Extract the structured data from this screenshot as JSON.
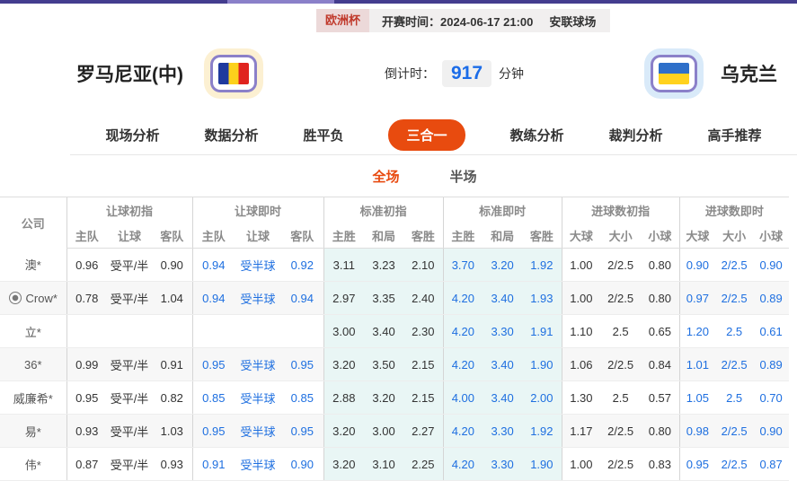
{
  "top_bar": {
    "accent_color": "#443d8f",
    "highlight_color": "#8a80c9"
  },
  "match_header": {
    "league": "欧洲杯",
    "kickoff_label": "开赛时间：2024-06-17 21:00",
    "venue": "安联球场"
  },
  "teams": {
    "home": {
      "name": "罗马尼亚(中)",
      "flag": "romania-flag"
    },
    "away": {
      "name": "乌克兰",
      "flag": "ukraine-flag"
    }
  },
  "countdown": {
    "label": "倒计时：",
    "value": "917",
    "unit": "分钟"
  },
  "nav_tabs": [
    {
      "label": "现场分析",
      "active": false
    },
    {
      "label": "数据分析",
      "active": false
    },
    {
      "label": "胜平负",
      "active": false
    },
    {
      "label": "三合一",
      "active": true
    },
    {
      "label": "教练分析",
      "active": false
    },
    {
      "label": "裁判分析",
      "active": false
    },
    {
      "label": "高手推荐",
      "active": false
    }
  ],
  "sub_tabs": [
    {
      "label": "全场",
      "active": true
    },
    {
      "label": "半场",
      "active": false
    }
  ],
  "odds_table": {
    "company_header": "公司",
    "groups": [
      {
        "label": "让球初指",
        "columns": [
          "主队",
          "让球",
          "客队"
        ]
      },
      {
        "label": "让球即时",
        "columns": [
          "主队",
          "让球",
          "客队"
        ]
      },
      {
        "label": "标准初指",
        "columns": [
          "主胜",
          "和局",
          "客胜"
        ]
      },
      {
        "label": "标准即时",
        "columns": [
          "主胜",
          "和局",
          "客胜"
        ]
      },
      {
        "label": "进球数初指",
        "columns": [
          "大球",
          "大小",
          "小球"
        ]
      },
      {
        "label": "进球数即时",
        "columns": [
          "大球",
          "大小",
          "小球"
        ]
      }
    ],
    "blue_columns": [
      3,
      4,
      5,
      9,
      10,
      11,
      15,
      16,
      17
    ],
    "tint_columns": [
      6,
      7,
      8,
      9,
      10,
      11
    ],
    "accent_blue": "#1e6fe0",
    "tint_color": "#e9f6f5",
    "rows": [
      {
        "company": "澳*",
        "has_icon": false,
        "values": [
          "0.96",
          "受平/半",
          "0.90",
          "0.94",
          "受半球",
          "0.92",
          "3.11",
          "3.23",
          "2.10",
          "3.70",
          "3.20",
          "1.92",
          "1.00",
          "2/2.5",
          "0.80",
          "0.90",
          "2/2.5",
          "0.90"
        ]
      },
      {
        "company": "Crow*",
        "has_icon": true,
        "values": [
          "0.78",
          "受平/半",
          "1.04",
          "0.94",
          "受半球",
          "0.94",
          "2.97",
          "3.35",
          "2.40",
          "4.20",
          "3.40",
          "1.93",
          "1.00",
          "2/2.5",
          "0.80",
          "0.97",
          "2/2.5",
          "0.89"
        ]
      },
      {
        "company": "立*",
        "has_icon": false,
        "values": [
          "",
          "",
          "",
          "",
          "",
          "",
          "3.00",
          "3.40",
          "2.30",
          "4.20",
          "3.30",
          "1.91",
          "1.10",
          "2.5",
          "0.65",
          "1.20",
          "2.5",
          "0.61"
        ]
      },
      {
        "company": "36*",
        "has_icon": false,
        "values": [
          "0.99",
          "受平/半",
          "0.91",
          "0.95",
          "受半球",
          "0.95",
          "3.20",
          "3.50",
          "2.15",
          "4.20",
          "3.40",
          "1.90",
          "1.06",
          "2/2.5",
          "0.84",
          "1.01",
          "2/2.5",
          "0.89"
        ]
      },
      {
        "company": "威廉希*",
        "has_icon": false,
        "values": [
          "0.95",
          "受平/半",
          "0.82",
          "0.85",
          "受半球",
          "0.85",
          "2.88",
          "3.20",
          "2.15",
          "4.00",
          "3.40",
          "2.00",
          "1.30",
          "2.5",
          "0.57",
          "1.05",
          "2.5",
          "0.70"
        ]
      },
      {
        "company": "易*",
        "has_icon": false,
        "values": [
          "0.93",
          "受平/半",
          "1.03",
          "0.95",
          "受半球",
          "0.95",
          "3.20",
          "3.00",
          "2.27",
          "4.20",
          "3.30",
          "1.92",
          "1.17",
          "2/2.5",
          "0.80",
          "0.98",
          "2/2.5",
          "0.90"
        ]
      },
      {
        "company": "伟*",
        "has_icon": false,
        "values": [
          "0.87",
          "受平/半",
          "0.93",
          "0.91",
          "受半球",
          "0.90",
          "3.20",
          "3.10",
          "2.25",
          "4.20",
          "3.30",
          "1.90",
          "1.00",
          "2/2.5",
          "0.83",
          "0.95",
          "2/2.5",
          "0.87"
        ]
      }
    ]
  }
}
